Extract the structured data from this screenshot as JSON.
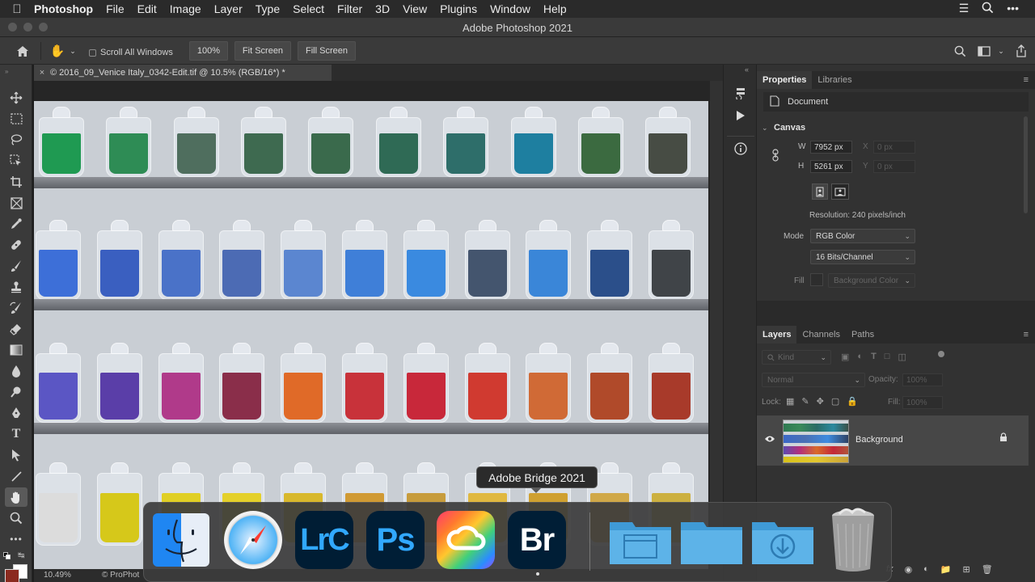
{
  "menubar": {
    "app_name": "Photoshop",
    "items": [
      "File",
      "Edit",
      "Image",
      "Layer",
      "Type",
      "Select",
      "Filter",
      "3D",
      "View",
      "Plugins",
      "Window",
      "Help"
    ]
  },
  "window": {
    "title": "Adobe Photoshop 2021"
  },
  "options_bar": {
    "scroll_all_windows": "Scroll All Windows",
    "zoom": "100%",
    "fit_screen": "Fit Screen",
    "fill_screen": "Fill Screen"
  },
  "document": {
    "tab_title": "© 2016_09_Venice Italy_0342-Edit.tif @ 10.5% (RGB/16*) *"
  },
  "status_bar": {
    "zoom": "10.49%",
    "profile": "© ProPhot"
  },
  "properties": {
    "tabs": [
      "Properties",
      "Libraries"
    ],
    "doc_label": "Document",
    "section": "Canvas",
    "w_label": "W",
    "w_value": "7952 px",
    "h_label": "H",
    "h_value": "5261 px",
    "x_label": "X",
    "x_value": "0 px",
    "y_label": "Y",
    "y_value": "0 px",
    "resolution": "Resolution: 240 pixels/inch",
    "mode_label": "Mode",
    "mode_value": "RGB Color",
    "bits_value": "16 Bits/Channel",
    "fill_label": "Fill",
    "fill_value": "Background Color"
  },
  "layers": {
    "tabs": [
      "Layers",
      "Channels",
      "Paths"
    ],
    "kind_placeholder": "Kind",
    "blend_mode": "Normal",
    "opacity_label": "Opacity:",
    "opacity_value": "100%",
    "lock_label": "Lock:",
    "fill_label": "Fill:",
    "fill_value": "100%",
    "layer_name": "Background"
  },
  "dock": {
    "tooltip": "Adobe Bridge 2021",
    "apps": [
      {
        "name": "Finder",
        "label": ""
      },
      {
        "name": "Safari",
        "label": ""
      },
      {
        "name": "Lightroom Classic",
        "label": "LrC"
      },
      {
        "name": "Photoshop",
        "label": "Ps"
      },
      {
        "name": "Creative Cloud",
        "label": ""
      },
      {
        "name": "Bridge",
        "label": "Br"
      }
    ]
  },
  "colors": {
    "foreground_swatch": "#8b2a1f",
    "background_swatch": "#ffffff",
    "ps_blue": "#31a8ff"
  }
}
